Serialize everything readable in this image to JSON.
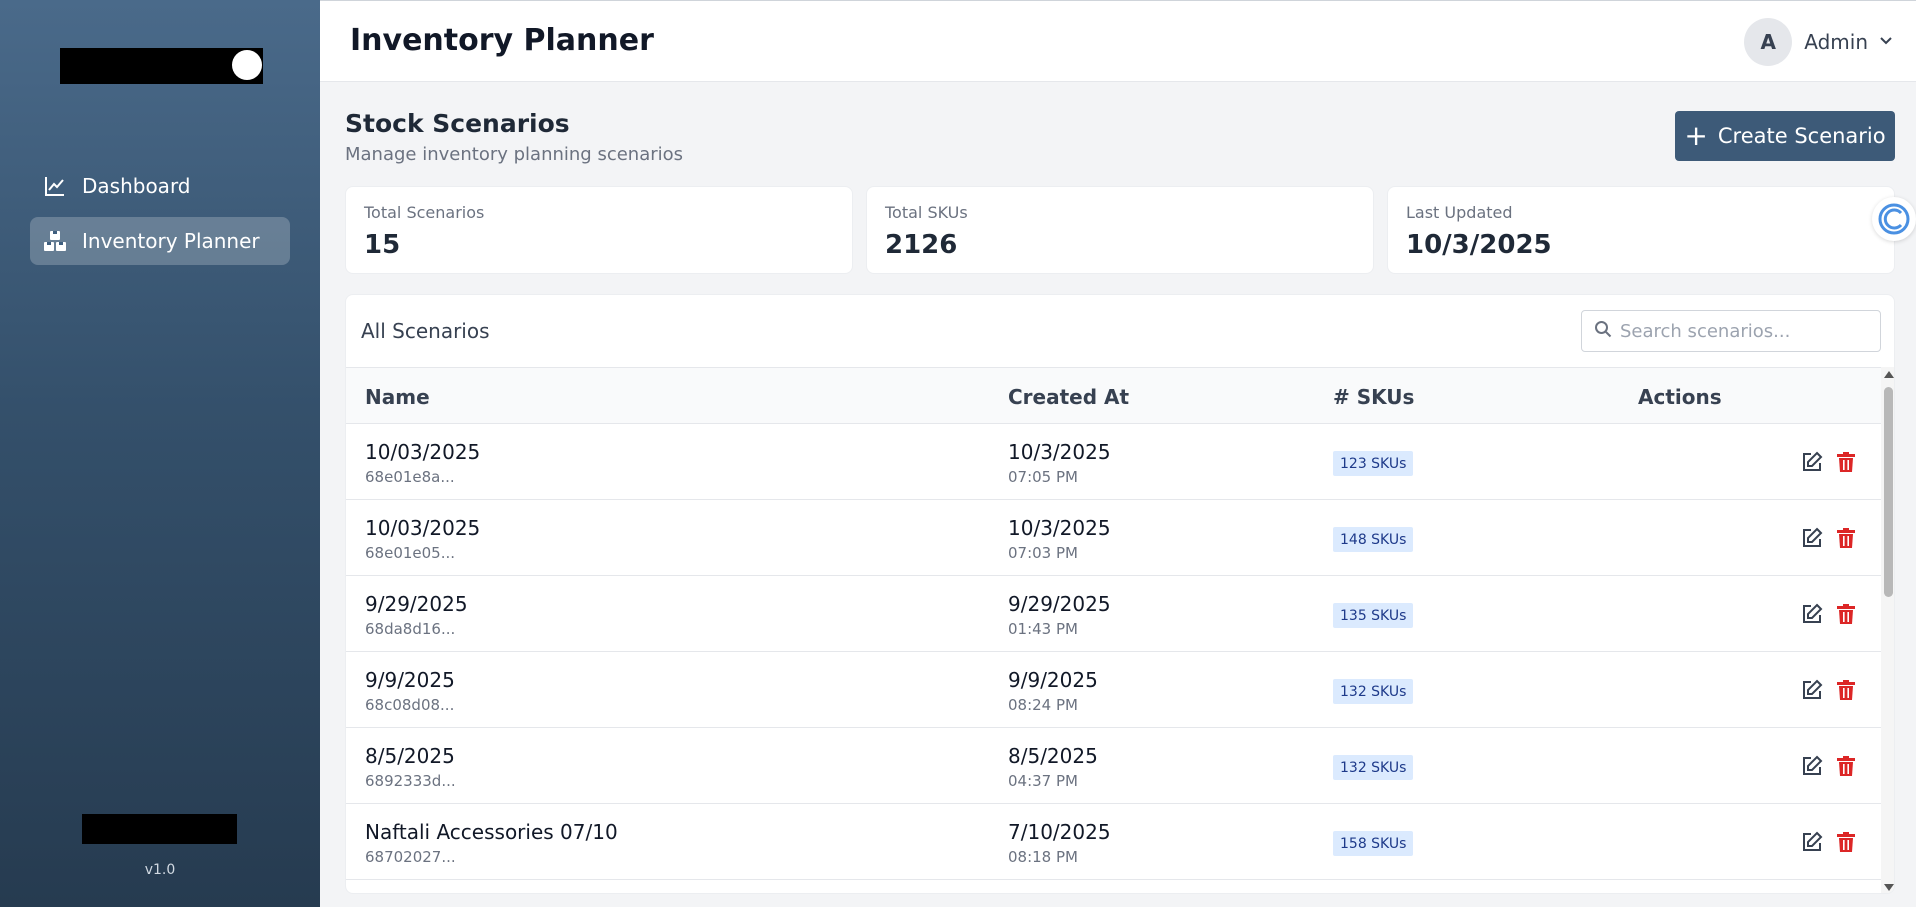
{
  "sidebar": {
    "items": [
      {
        "label": "Dashboard",
        "icon": "chart-line-icon",
        "active": false
      },
      {
        "label": "Inventory Planner",
        "icon": "boxes-icon",
        "active": true
      }
    ],
    "version": "v1.0"
  },
  "header": {
    "title": "Inventory Planner",
    "user_initial": "A",
    "user_name": "Admin"
  },
  "main": {
    "section_title": "Stock Scenarios",
    "section_subtitle": "Manage inventory planning scenarios",
    "create_button_label": "Create Scenario",
    "stats": [
      {
        "label": "Total Scenarios",
        "value": "15"
      },
      {
        "label": "Total SKUs",
        "value": "2126"
      },
      {
        "label": "Last Updated",
        "value": "10/3/2025"
      }
    ],
    "panel": {
      "title": "All Scenarios",
      "search_placeholder": "Search scenarios...",
      "columns": [
        "Name",
        "Created At",
        "# SKUs",
        "Actions"
      ],
      "rows": [
        {
          "name": "10/03/2025",
          "id": "68e01e8a...",
          "date": "10/3/2025",
          "time": "07:05 PM",
          "skus": "123 SKUs"
        },
        {
          "name": "10/03/2025",
          "id": "68e01e05...",
          "date": "10/3/2025",
          "time": "07:03 PM",
          "skus": "148 SKUs"
        },
        {
          "name": "9/29/2025",
          "id": "68da8d16...",
          "date": "9/29/2025",
          "time": "01:43 PM",
          "skus": "135 SKUs"
        },
        {
          "name": "9/9/2025",
          "id": "68c08d08...",
          "date": "9/9/2025",
          "time": "08:24 PM",
          "skus": "132 SKUs"
        },
        {
          "name": "8/5/2025",
          "id": "6892333d...",
          "date": "8/5/2025",
          "time": "04:37 PM",
          "skus": "132 SKUs"
        },
        {
          "name": "Naftali Accessories 07/10",
          "id": "68702027...",
          "date": "7/10/2025",
          "time": "08:18 PM",
          "skus": "158 SKUs"
        }
      ]
    }
  },
  "colors": {
    "sidebar_top": "#4a6a8a",
    "sidebar_bottom": "#263b50",
    "primary_button": "#3d5a78",
    "badge_bg": "#dbeafe",
    "badge_text": "#1e3a8a",
    "delete_red": "#dc2626"
  }
}
